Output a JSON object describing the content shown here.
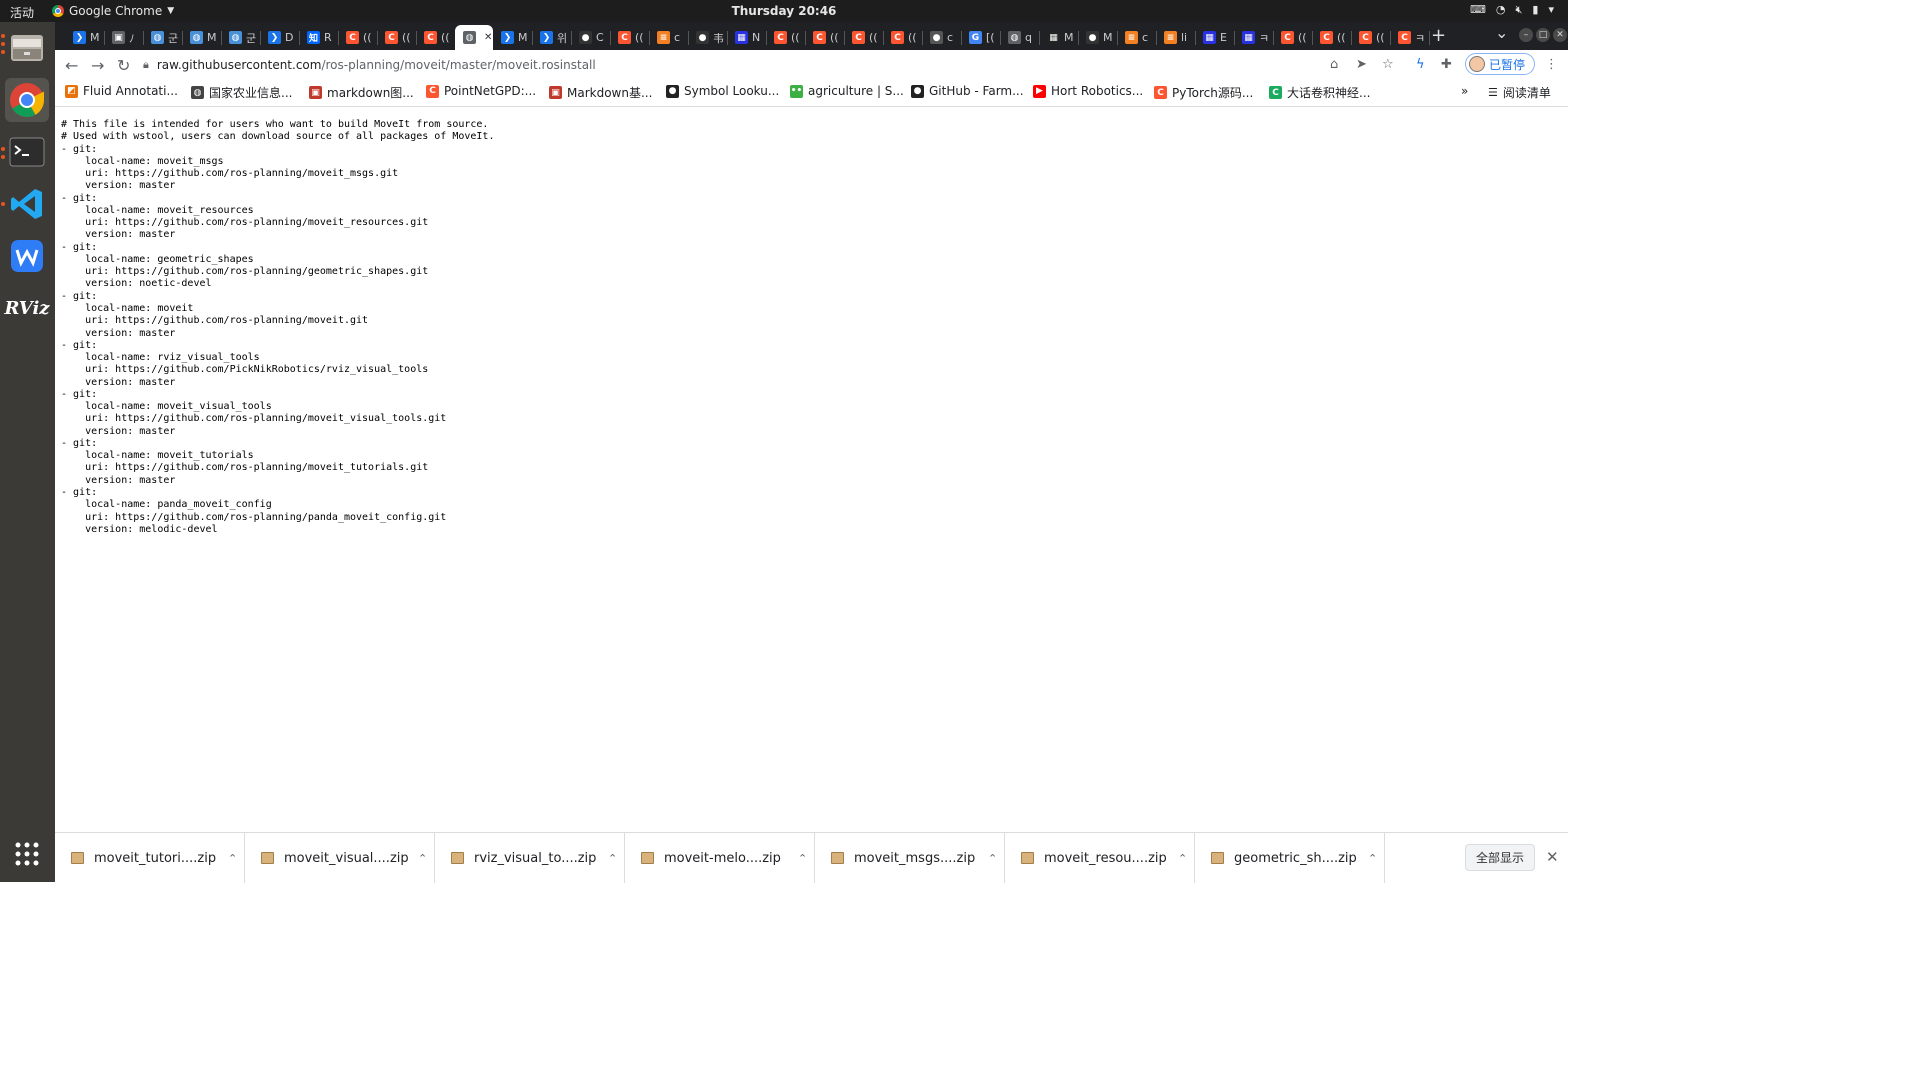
{
  "system": {
    "activities": "活动",
    "app_menu": "Google Chrome",
    "clock": "Thursday 20:46"
  },
  "tabs": [
    {
      "label": "M",
      "icon": "chevron-right-icon",
      "color": "#1a73e8"
    },
    {
      "label": "ﾉ",
      "icon": "generic-icon",
      "color": "#5f6368"
    },
    {
      "label": "군",
      "icon": "globe-icon",
      "color": "#4a90d9"
    },
    {
      "label": "M",
      "icon": "globe-icon",
      "color": "#4a90d9"
    },
    {
      "label": "군",
      "icon": "globe-icon",
      "color": "#4a90d9"
    },
    {
      "label": "D",
      "icon": "chevron-right-icon",
      "color": "#1a73e8"
    },
    {
      "label": "R",
      "icon": "zhihu-icon",
      "color": "#0066ff"
    },
    {
      "label": "((",
      "icon": "csdn-icon",
      "color": "#fc5531"
    },
    {
      "label": "((",
      "icon": "csdn-icon",
      "color": "#fc5531"
    },
    {
      "label": "((",
      "icon": "csdn-icon",
      "color": "#fc5531"
    },
    {
      "label": "",
      "icon": "globe-icon",
      "color": "#5f6368",
      "active": true
    },
    {
      "label": "M",
      "icon": "chevron-right-icon",
      "color": "#1a73e8"
    },
    {
      "label": "위",
      "icon": "chevron-right-icon",
      "color": "#1a73e8"
    },
    {
      "label": "C",
      "icon": "github-icon",
      "color": "#333333"
    },
    {
      "label": "((",
      "icon": "csdn-icon",
      "color": "#fc5531"
    },
    {
      "label": "c",
      "icon": "stackoverflow-icon",
      "color": "#f48024"
    },
    {
      "label": "韦",
      "icon": "github-icon",
      "color": "#333333"
    },
    {
      "label": "N",
      "icon": "baidu-icon",
      "color": "#2932e1"
    },
    {
      "label": "((",
      "icon": "csdn-icon",
      "color": "#fc5531"
    },
    {
      "label": "((",
      "icon": "csdn-icon",
      "color": "#fc5531"
    },
    {
      "label": "((",
      "icon": "csdn-icon",
      "color": "#fc5531"
    },
    {
      "label": "((",
      "icon": "csdn-icon",
      "color": "#fc5531"
    },
    {
      "label": "c",
      "icon": "github-icon",
      "color": "#555555"
    },
    {
      "label": "[(",
      "icon": "google-icon",
      "color": "#4285f4"
    },
    {
      "label": "q",
      "icon": "globe-icon",
      "color": "#5f6368"
    },
    {
      "label": "M",
      "icon": "grid-icon",
      "color": "#222222"
    },
    {
      "label": "M",
      "icon": "github-icon",
      "color": "#333333"
    },
    {
      "label": "c",
      "icon": "stackoverflow-icon",
      "color": "#f48024"
    },
    {
      "label": "li",
      "icon": "stackoverflow-icon",
      "color": "#f48024"
    },
    {
      "label": "E",
      "icon": "baidu-icon",
      "color": "#2932e1"
    },
    {
      "label": "ㅋ",
      "icon": "baidu-icon",
      "color": "#2932e1"
    },
    {
      "label": "((",
      "icon": "csdn-icon",
      "color": "#fc5531"
    },
    {
      "label": "((",
      "icon": "csdn-icon",
      "color": "#fc5531"
    },
    {
      "label": "((",
      "icon": "csdn-icon",
      "color": "#fc5531"
    },
    {
      "label": "ㅋ",
      "icon": "csdn-icon",
      "color": "#fc5531"
    }
  ],
  "toolbar": {
    "url_host": "raw.githubusercontent.com",
    "url_path": "/ros-planning/moveit/master/moveit.rosinstall",
    "profile_label": "已暂停"
  },
  "bookmarks": {
    "items": [
      {
        "label": "Fluid Annotati...",
        "icon": "fluid-icon",
        "color": "#e8710a"
      },
      {
        "label": "国家农业信息...",
        "icon": "globe-icon",
        "color": "#444444"
      },
      {
        "label": "markdown图...",
        "icon": "markdown-icon",
        "color": "#c0392b"
      },
      {
        "label": "PointNetGPD:...",
        "icon": "csdn-icon",
        "color": "#fc5531"
      },
      {
        "label": "Markdown基...",
        "icon": "markdown-icon",
        "color": "#c0392b"
      },
      {
        "label": "Symbol Looku...",
        "icon": "github-icon",
        "color": "#222222"
      },
      {
        "label": "agriculture | S...",
        "icon": "agriculture-icon",
        "color": "#3cb043"
      },
      {
        "label": "GitHub - Farm...",
        "icon": "github-icon",
        "color": "#222222"
      },
      {
        "label": "Hort Robotics...",
        "icon": "youtube-icon",
        "color": "#ff0000"
      },
      {
        "label": "PyTorch源码...",
        "icon": "csdn-icon",
        "color": "#fc5531"
      },
      {
        "label": "大话卷积神经...",
        "icon": "refresh-c-icon",
        "color": "#1aab5e"
      }
    ],
    "overflow": "»",
    "reading_list": "阅读清单"
  },
  "file": {
    "lines": [
      "# This file is intended for users who want to build MoveIt from source.",
      "# Used with wstool, users can download source of all packages of MoveIt.",
      "- git:",
      "    local-name: moveit_msgs",
      "    uri: https://github.com/ros-planning/moveit_msgs.git",
      "    version: master",
      "- git:",
      "    local-name: moveit_resources",
      "    uri: https://github.com/ros-planning/moveit_resources.git",
      "    version: master",
      "- git:",
      "    local-name: geometric_shapes",
      "    uri: https://github.com/ros-planning/geometric_shapes.git",
      "    version: noetic-devel",
      "- git:",
      "    local-name: moveit",
      "    uri: https://github.com/ros-planning/moveit.git",
      "    version: master",
      "- git:",
      "    local-name: rviz_visual_tools",
      "    uri: https://github.com/PickNikRobotics/rviz_visual_tools",
      "    version: master",
      "- git:",
      "    local-name: moveit_visual_tools",
      "    uri: https://github.com/ros-planning/moveit_visual_tools.git",
      "    version: master",
      "- git:",
      "    local-name: moveit_tutorials",
      "    uri: https://github.com/ros-planning/moveit_tutorials.git",
      "    version: master",
      "- git:",
      "    local-name: panda_moveit_config",
      "    uri: https://github.com/ros-planning/panda_moveit_config.git",
      "    version: melodic-devel"
    ]
  },
  "downloads": {
    "items": [
      {
        "name": "moveit_tutori....zip"
      },
      {
        "name": "moveit_visual....zip"
      },
      {
        "name": "rviz_visual_to....zip"
      },
      {
        "name": "moveit-melo....zip"
      },
      {
        "name": "moveit_msgs....zip"
      },
      {
        "name": "moveit_resou....zip"
      },
      {
        "name": "geometric_sh....zip"
      }
    ],
    "show_all": "全部显示"
  }
}
